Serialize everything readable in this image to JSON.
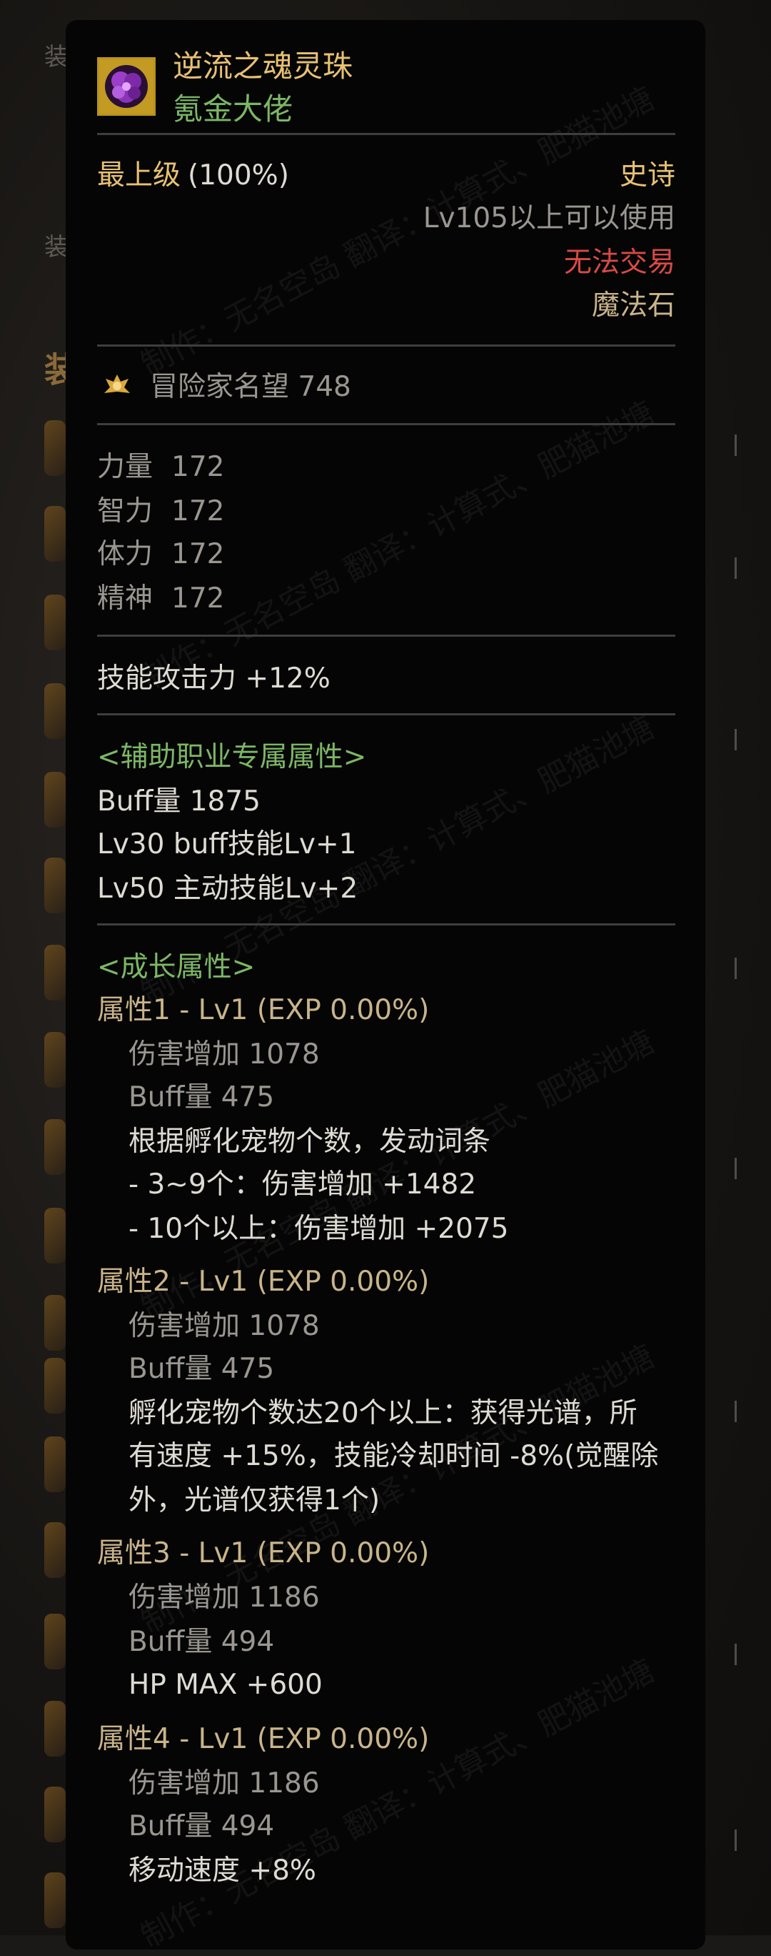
{
  "background": {
    "labels": [
      "装",
      "装",
      "装"
    ],
    "colors": {
      "panel": "#050505",
      "gold": "#e7c173",
      "green": "#7cb765",
      "red": "#d94a46"
    }
  },
  "item": {
    "name": "逆流之魂灵珠",
    "subtitle": "氪金大佬",
    "grade_label": "最上级",
    "grade_value": "(100%)",
    "rarity": "史诗",
    "level_req": "Lv105以上可以使用",
    "trade": "无法交易",
    "type": "魔法石",
    "icon": "purple-flower-orb-icon"
  },
  "reputation": {
    "icon": "reputation-crest-icon",
    "text": "冒险家名望 748"
  },
  "stats": [
    {
      "name": "力量",
      "value": "172"
    },
    {
      "name": "智力",
      "value": "172"
    },
    {
      "name": "体力",
      "value": "172"
    },
    {
      "name": "精神",
      "value": "172"
    }
  ],
  "skill_attack": "技能攻击力  +12%",
  "support": {
    "header": "<辅助职业专属属性>",
    "lines": [
      "Buff量   1875",
      "Lv30 buff技能Lv+1",
      "Lv50 主动技能Lv+2"
    ]
  },
  "growth": {
    "header": "<成长属性>",
    "attrs": [
      {
        "title": "属性1 - Lv1 (EXP 0.00%)",
        "damage": "伤害增加   1078",
        "buff": "Buff量   475",
        "effects": [
          "根据孵化宠物个数，发动词条",
          "- 3~9个：伤害增加 +1482",
          "- 10个以上：伤害增加 +2075"
        ]
      },
      {
        "title": "属性2 - Lv1 (EXP 0.00%)",
        "damage": "伤害增加   1078",
        "buff": "Buff量   475",
        "effects": [
          "孵化宠物个数达20个以上：获得光谱，所",
          "有速度 +15%，技能冷却时间 -8%(觉醒除",
          "外，光谱仅获得1个)"
        ]
      },
      {
        "title": "属性3 - Lv1 (EXP 0.00%)",
        "damage": "伤害增加   1186",
        "buff": "Buff量   494",
        "effects": [
          "HP MAX +600"
        ]
      },
      {
        "title": "属性4 - Lv1 (EXP 0.00%)",
        "damage": "伤害增加   1186",
        "buff": "Buff量   494",
        "effects": [
          "移动速度 +8%"
        ]
      }
    ]
  },
  "watermark": "制作：无名空岛  翻译：计算式、肥猫池塘"
}
